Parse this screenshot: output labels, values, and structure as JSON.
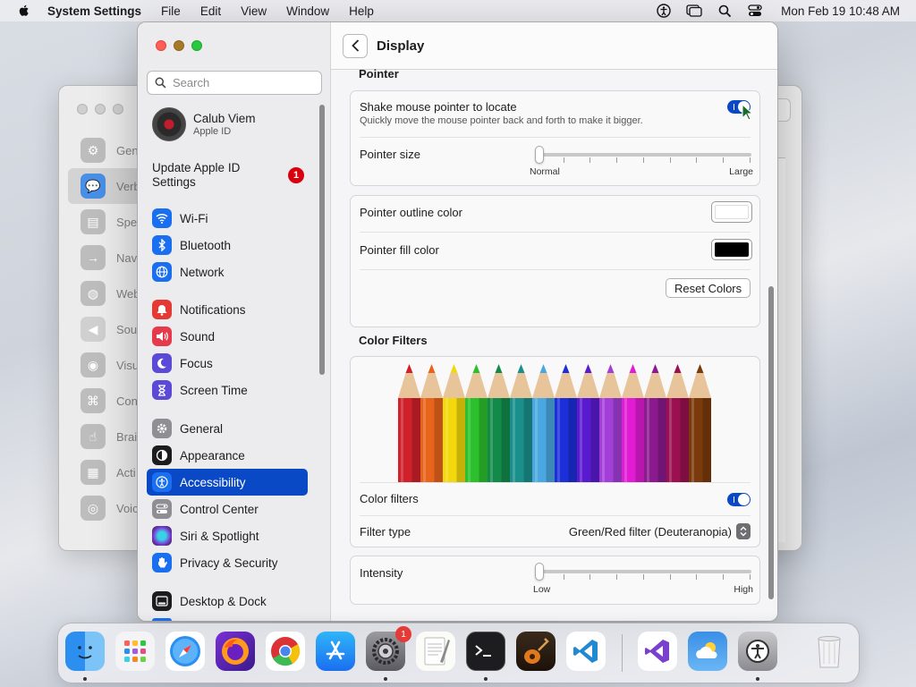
{
  "menubar": {
    "app_name": "System Settings",
    "items": [
      "File",
      "Edit",
      "View",
      "Window",
      "Help"
    ],
    "clock": "Mon Feb 19  10:48 AM"
  },
  "background_window": {
    "rows": [
      "Gen",
      "Verb",
      "Spe",
      "Nav",
      "Web",
      "Sou",
      "Visu",
      "Con",
      "Brai",
      "Acti",
      "Voic"
    ]
  },
  "sidebar": {
    "search_placeholder": "Search",
    "profile_name": "Calub Viem",
    "profile_sub": "Apple ID",
    "update_label": "Update Apple ID Settings",
    "update_badge": "1",
    "group1": [
      {
        "label": "Wi-Fi",
        "icon": "wifi-icon",
        "color": "#1a6ff0"
      },
      {
        "label": "Bluetooth",
        "icon": "bluetooth-icon",
        "color": "#1a6ff0"
      },
      {
        "label": "Network",
        "icon": "globe-icon",
        "color": "#1a6ff0"
      }
    ],
    "group2": [
      {
        "label": "Notifications",
        "icon": "bell-icon",
        "color": "#e53a34"
      },
      {
        "label": "Sound",
        "icon": "speaker-icon",
        "color": "#e53a4c"
      },
      {
        "label": "Focus",
        "icon": "moon-icon",
        "color": "#5b4ad6"
      },
      {
        "label": "Screen Time",
        "icon": "hourglass-icon",
        "color": "#5b4ad6"
      }
    ],
    "group3": [
      {
        "label": "General",
        "icon": "gear-icon",
        "color": "#8e8e93"
      },
      {
        "label": "Appearance",
        "icon": "appearance-icon",
        "color": "#1c1c1e"
      },
      {
        "label": "Accessibility",
        "icon": "accessibility-icon",
        "color": "#1a6ff0"
      },
      {
        "label": "Control Center",
        "icon": "control-center-icon",
        "color": "#8e8e93"
      },
      {
        "label": "Siri & Spotlight",
        "icon": "siri-icon",
        "color": "#7a3dd6"
      },
      {
        "label": "Privacy & Security",
        "icon": "hand-icon",
        "color": "#1a6ff0"
      }
    ],
    "group4": [
      {
        "label": "Desktop & Dock",
        "icon": "dock-icon",
        "color": "#1c1c1e"
      }
    ],
    "selected": "Accessibility"
  },
  "content": {
    "title": "Display",
    "pointer_section": "Pointer",
    "shake_title": "Shake mouse pointer to locate",
    "shake_sub": "Quickly move the mouse pointer back and forth to make it bigger.",
    "shake_on": true,
    "pointer_size_label": "Pointer size",
    "pointer_size_min": "Normal",
    "pointer_size_max": "Large",
    "pointer_size_value": 0,
    "outline_label": "Pointer outline color",
    "outline_color": "#ffffff",
    "fill_label": "Pointer fill color",
    "fill_color": "#000000",
    "reset_label": "Reset Colors",
    "color_filters_section": "Color Filters",
    "pencil_colors": [
      "#d0202a",
      "#e8641c",
      "#f2d80c",
      "#2cc02c",
      "#138a4a",
      "#1a8f8c",
      "#4aa8e0",
      "#1c2fd8",
      "#5a1ad0",
      "#a33fd8",
      "#e21bd4",
      "#8a1a8e",
      "#9a1050",
      "#7a3a0c"
    ],
    "color_filters_label": "Color filters",
    "color_filters_on": true,
    "filter_type_label": "Filter type",
    "filter_type_value": "Green/Red filter (Deuteranopia)",
    "intensity_label": "Intensity",
    "intensity_min": "Low",
    "intensity_max": "High",
    "intensity_value": 0
  },
  "dock": {
    "apps": [
      "Finder",
      "Launchpad",
      "Safari",
      "Firefox",
      "Chrome",
      "App Store",
      "System Settings",
      "TextEdit",
      "Terminal",
      "GarageBand",
      "VS Code",
      "Visual Studio",
      "Weather",
      "Accessibility Inspector",
      "Trash"
    ],
    "settings_badge": "1"
  }
}
